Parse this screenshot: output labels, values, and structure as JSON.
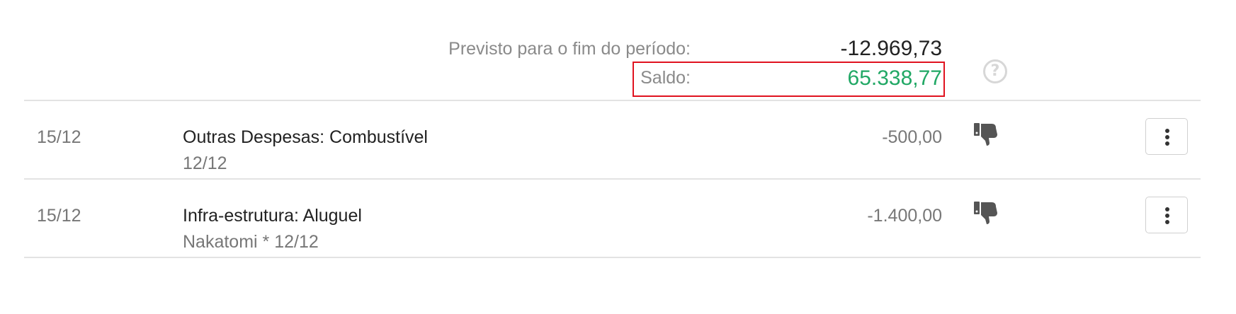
{
  "summary": {
    "forecast_label": "Previsto para o fim do período:",
    "forecast_value": "-12.969,73",
    "saldo_label": "Saldo:",
    "saldo_value": "65.338,77",
    "help_icon": "question-circle-icon"
  },
  "colors": {
    "positive": "#21a865",
    "highlight": "#e0121f"
  },
  "transactions": [
    {
      "date": "15/12",
      "title": "Outras Despesas: Combustível",
      "subtitle": "12/12",
      "amount": "-500,00",
      "status_icon": "thumbs-down-icon",
      "menu_icon": "vertical-ellipsis-icon"
    },
    {
      "date": "15/12",
      "title": "Infra-estrutura: Aluguel",
      "subtitle": "Nakatomi * 12/12",
      "amount": "-1.400,00",
      "status_icon": "thumbs-down-icon",
      "menu_icon": "vertical-ellipsis-icon"
    }
  ]
}
